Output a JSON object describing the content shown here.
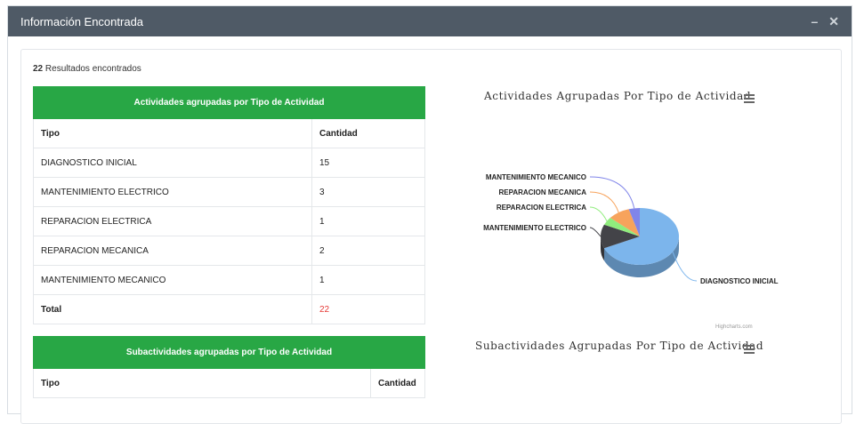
{
  "modal": {
    "title": "Información Encontrada",
    "minimize_icon": "minus-icon",
    "close_icon": "close-icon"
  },
  "results": {
    "count": "22",
    "label": "Resultados encontrados"
  },
  "table1": {
    "title": "Actividades agrupadas por Tipo de Actividad",
    "col_tipo": "Tipo",
    "col_cantidad": "Cantidad",
    "rows": [
      {
        "tipo": "DIAGNOSTICO INICIAL",
        "cantidad": "15"
      },
      {
        "tipo": "MANTENIMIENTO ELECTRICO",
        "cantidad": "3"
      },
      {
        "tipo": "REPARACION ELECTRICA",
        "cantidad": "1"
      },
      {
        "tipo": "REPARACION MECANICA",
        "cantidad": "2"
      },
      {
        "tipo": "MANTENIMIENTO MECANICO",
        "cantidad": "1"
      }
    ],
    "total_label": "Total",
    "total_value": "22"
  },
  "table2": {
    "title": "Subactividades agrupadas por Tipo de Actividad",
    "col_tipo": "Tipo",
    "col_cantidad": "Cantidad"
  },
  "chart1_title": "Actividades Agrupadas Por Tipo de Actividad",
  "chart2_title": "Subactividades Agrupadas Por Tipo de Actividad",
  "credit": "Highcharts.com",
  "colors": {
    "green": "#28a745",
    "header": "#4f5a66",
    "total_red": "#e53935"
  },
  "chart_data": {
    "type": "pie",
    "title": "Actividades Agrupadas Por Tipo de Actividad",
    "categories": [
      "DIAGNOSTICO INICIAL",
      "MANTENIMIENTO ELECTRICO",
      "REPARACION ELECTRICA",
      "REPARACION MECANICA",
      "MANTENIMIENTO MECANICO"
    ],
    "values": [
      15,
      3,
      1,
      2,
      1
    ],
    "colors": [
      "#7cb5ec",
      "#434348",
      "#90ed7d",
      "#f7a35c",
      "#8085e9"
    ]
  }
}
